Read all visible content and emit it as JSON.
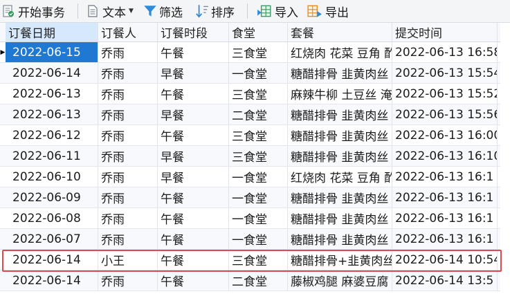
{
  "toolbar": {
    "begin_transaction": "开始事务",
    "text": "文本",
    "filter": "筛选",
    "sort": "排序",
    "import": "导入",
    "export": "导出"
  },
  "columns": [
    "订餐日期",
    "订餐人",
    "订餐时段",
    "食堂",
    "套餐",
    "提交时间"
  ],
  "rows": [
    [
      "2022-06-15",
      "乔雨",
      "午餐",
      "三食堂",
      "红烧肉 花菜 豆角 酢",
      "2022-06-13 16:58"
    ],
    [
      "2022-06-14",
      "乔雨",
      "早餐",
      "一食堂",
      "糖醋排骨 韭黄肉丝",
      "2022-06-13 15:54"
    ],
    [
      "2022-06-13",
      "乔雨",
      "午餐",
      "三食堂",
      "麻辣牛柳 土豆丝 淹",
      "2022-06-13 15:52"
    ],
    [
      "2022-06-13",
      "乔雨",
      "早餐",
      "二食堂",
      "糖醋排骨 韭黄肉丝",
      "2022-06-13 15:56"
    ],
    [
      "2022-06-12",
      "乔雨",
      "午餐",
      "三食堂",
      "糖醋排骨 韭黄肉丝",
      "2022-06-13 16:00"
    ],
    [
      "2022-06-11",
      "乔雨",
      "早餐",
      "三食堂",
      "糖醋排骨 韭黄肉丝",
      "2022-06-13 16:10"
    ],
    [
      "2022-06-10",
      "乔雨",
      "早餐",
      "一食堂",
      "红烧肉 花菜 豆角 酢",
      "2022-06-13 16:1"
    ],
    [
      "2022-06-09",
      "乔雨",
      "午餐",
      "一食堂",
      "糖醋排骨 韭黄肉丝",
      "2022-06-13 16:1"
    ],
    [
      "2022-06-08",
      "乔雨",
      "午餐",
      "一食堂",
      "糖醋排骨 韭黄肉丝",
      "2022-06-13 16:1"
    ],
    [
      "2022-06-07",
      "乔雨",
      "午餐",
      "一食堂",
      "糖醋排骨 韭黄肉丝",
      "2022-06-13 16:1"
    ],
    [
      "2022-06-14",
      "小王",
      "午餐",
      "三食堂",
      "糖醋排骨+韭黄肉丝",
      "2022-06-14 10:54"
    ],
    [
      "2022-06-14",
      "乔雨",
      "午餐",
      "二食堂",
      "藤椒鸡腿 麻婆豆腐",
      "2022-06-14 13:5"
    ]
  ],
  "colors": {
    "selected_cell": "#1f78d1",
    "header_selected": "#d6e8fb",
    "highlight_border": "#e0484f",
    "filter_icon": "#2f8bd8",
    "sort_icon": "#2f8bd8",
    "import_icon": "#2e9a5b",
    "export_icon": "#e08a1e"
  }
}
